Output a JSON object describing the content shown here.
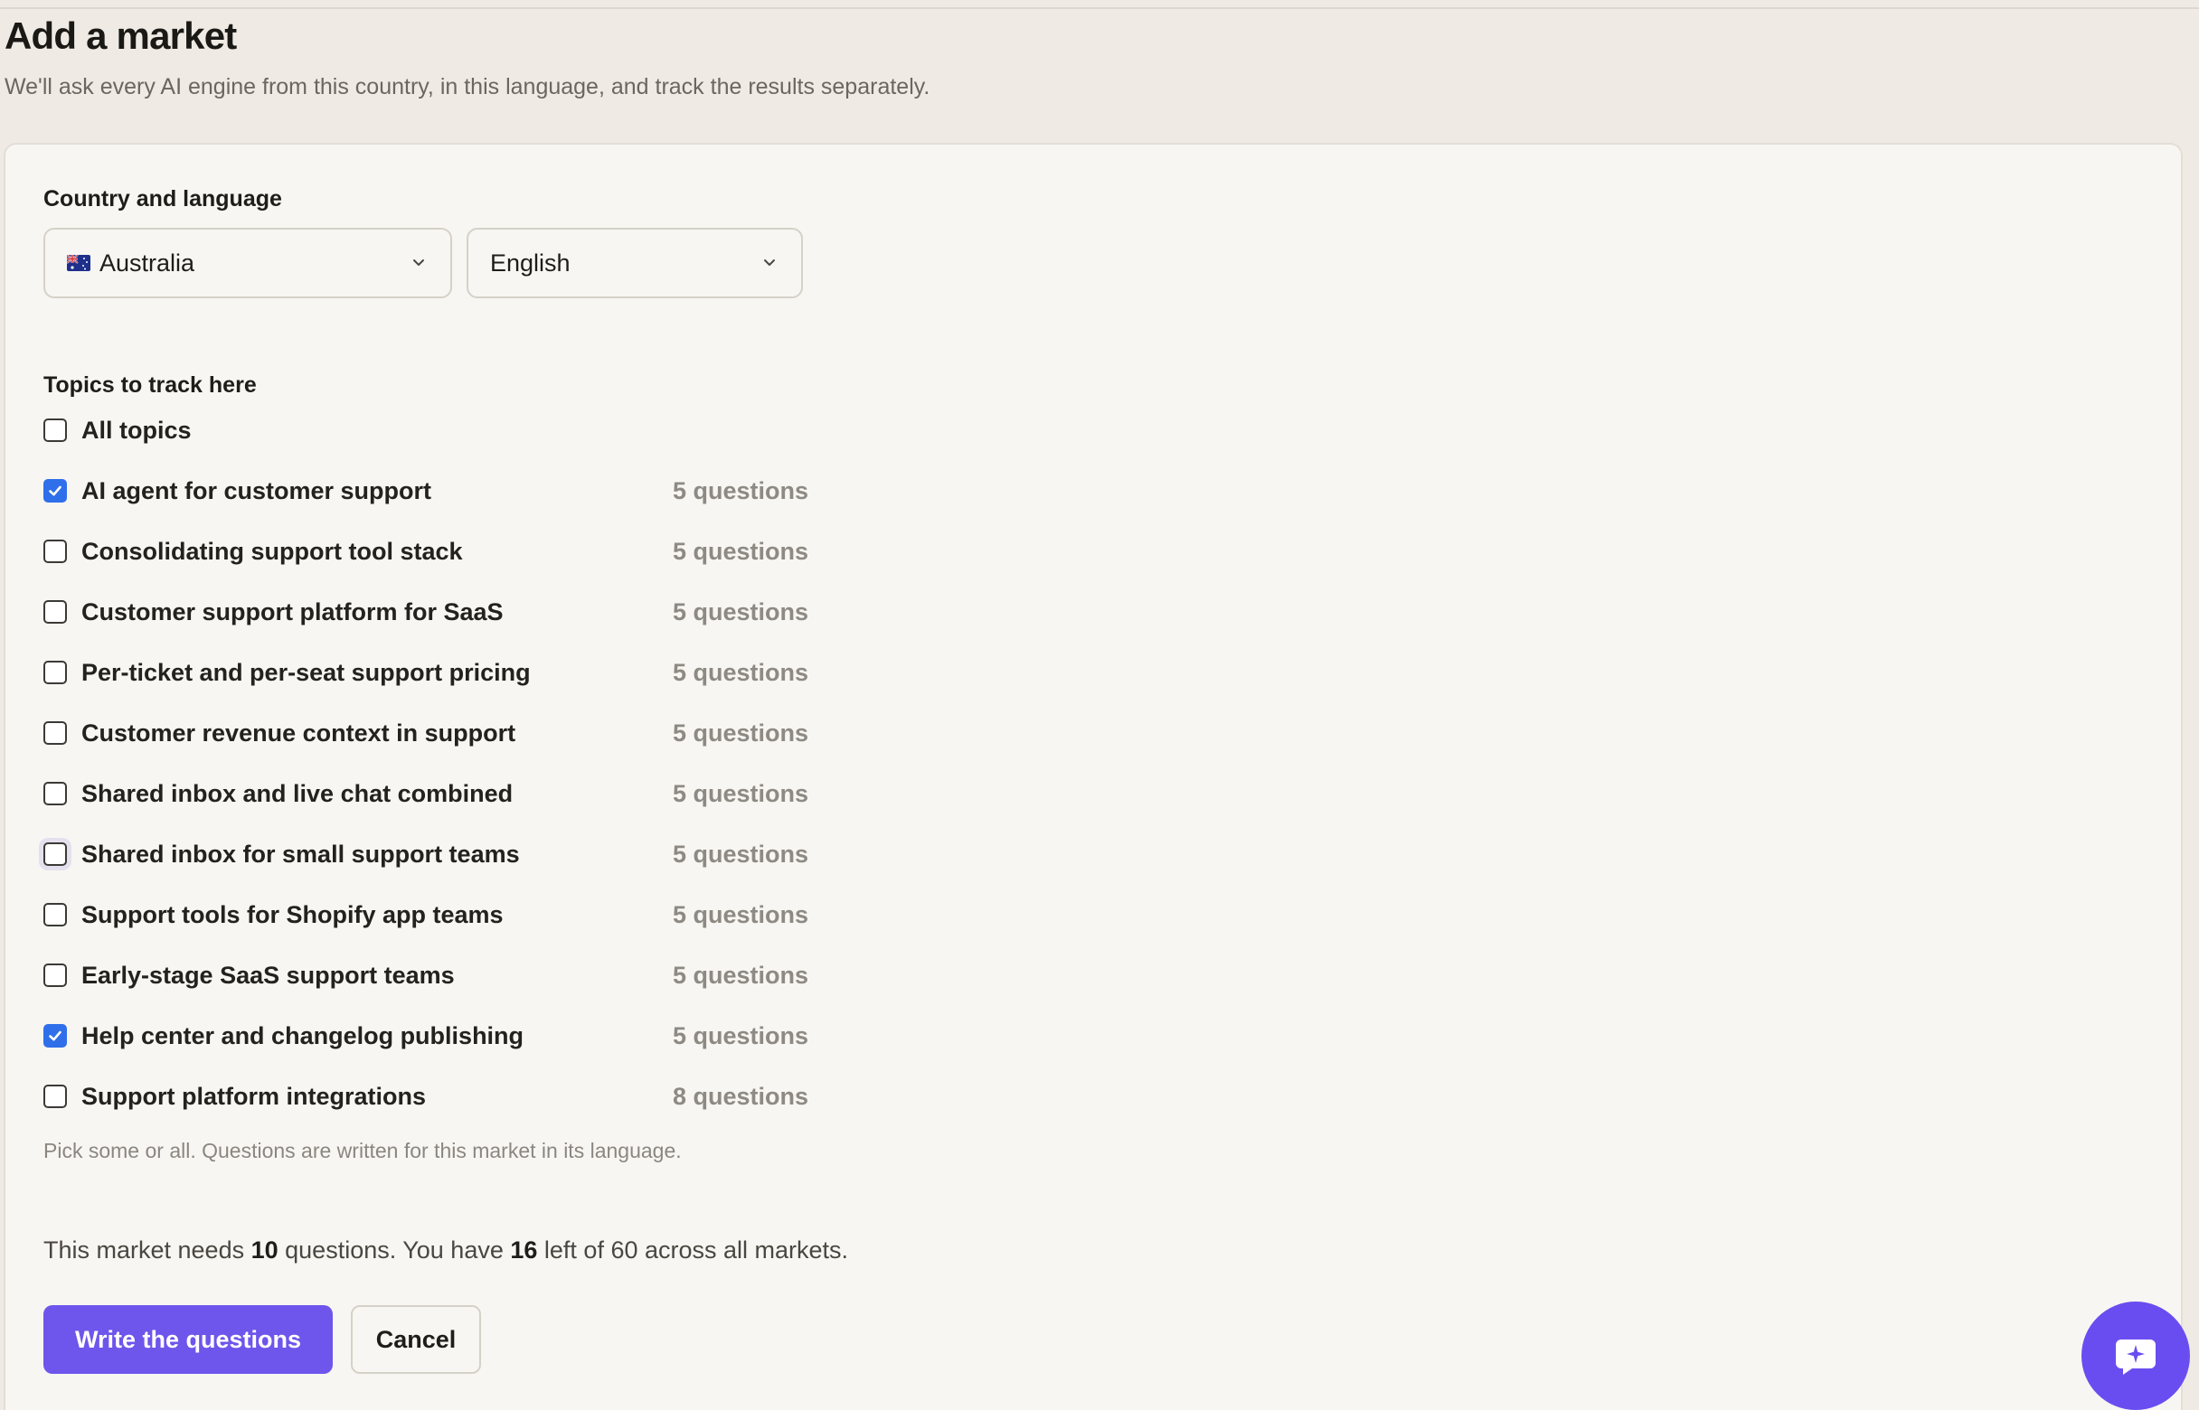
{
  "page": {
    "title": "Add a market",
    "subtitle": "We'll ask every AI engine from this country, in this language, and track the results separately."
  },
  "country_language": {
    "label": "Country and language",
    "country": {
      "value": "Australia",
      "icon": "australia-flag-icon"
    },
    "language": {
      "value": "English"
    }
  },
  "topics": {
    "label": "Topics to track here",
    "all_label": "All topics",
    "all_checked": false,
    "items": [
      {
        "label": "AI agent for customer support",
        "count": "5 questions",
        "checked": true
      },
      {
        "label": "Consolidating support tool stack",
        "count": "5 questions",
        "checked": false
      },
      {
        "label": "Customer support platform for SaaS",
        "count": "5 questions",
        "checked": false
      },
      {
        "label": "Per-ticket and per-seat support pricing",
        "count": "5 questions",
        "checked": false
      },
      {
        "label": "Customer revenue context in support",
        "count": "5 questions",
        "checked": false
      },
      {
        "label": "Shared inbox and live chat combined",
        "count": "5 questions",
        "checked": false
      },
      {
        "label": "Shared inbox for small support teams",
        "count": "5 questions",
        "checked": false
      },
      {
        "label": "Support tools for Shopify app teams",
        "count": "5 questions",
        "checked": false
      },
      {
        "label": "Early-stage SaaS support teams",
        "count": "5 questions",
        "checked": false
      },
      {
        "label": "Help center and changelog publishing",
        "count": "5 questions",
        "checked": true
      },
      {
        "label": "Support platform integrations",
        "count": "8 questions",
        "checked": false
      }
    ],
    "hint": "Pick some or all. Questions are written for this market in its language."
  },
  "summary": {
    "prefix": "This market needs ",
    "needed": "10",
    "middle": " questions. You have ",
    "left": "16",
    "suffix": " left of 60 across all markets."
  },
  "actions": {
    "primary_label": "Write the questions",
    "cancel_label": "Cancel"
  },
  "colors": {
    "accent": "#6e55eb",
    "checkbox_checked": "#2f6fea",
    "background": "#efebe4",
    "card": "#f8f6f2"
  },
  "chat": {
    "icon": "chat-sparkle-icon"
  }
}
